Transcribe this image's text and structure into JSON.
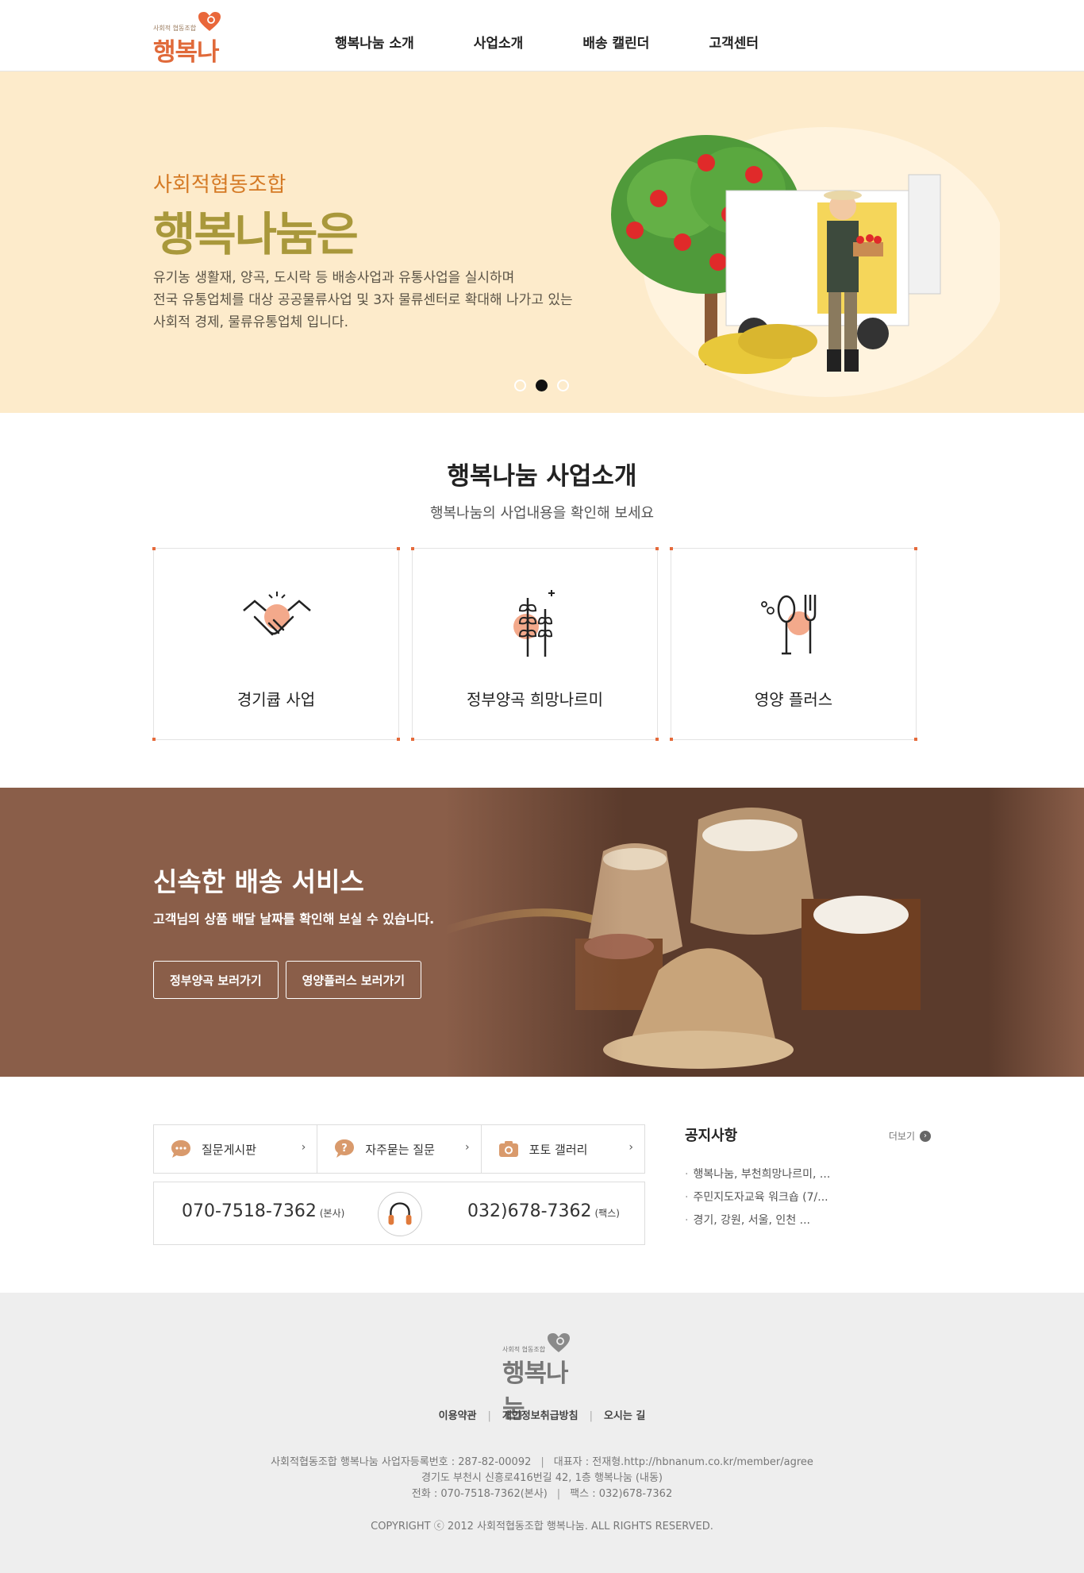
{
  "brand": {
    "small": "사회적 협동조합",
    "name": "행복나눔",
    "accent": "#e06a3a"
  },
  "nav": [
    "행복나눔 소개",
    "사업소개",
    "배송 캘린더",
    "고객센터"
  ],
  "hero": {
    "subtitle": "사회적협동조합",
    "title": "행복나눔은",
    "desc": [
      "유기농 생활재, 양곡, 도시락 등 배송사업과 유통사업을 실시하며",
      "전국 유통업체를 대상 공공물류사업 및 3자 물류센터로 확대해 나가고 있는",
      "사회적 경제, 물류유통업체 입니다."
    ],
    "slide_count": 3,
    "active_slide": 2,
    "background": "#fdebcb"
  },
  "business": {
    "heading": "행복나눔 사업소개",
    "sub": "행복나눔의 사업내용을 확인해 보세요",
    "cards": [
      {
        "label": "경기큡 사업",
        "icon": "handshake-icon"
      },
      {
        "label": "정부양곡 희망나르미",
        "icon": "wheat-icon"
      },
      {
        "label": "영양 플러스",
        "icon": "spoon-fork-icon"
      }
    ]
  },
  "delivery": {
    "title": "신속한 배송 서비스",
    "desc": "고객님의 상품 배달 날짜를 확인해 보실 수 있습니다.",
    "buttons": [
      "정부양곡 보러가기",
      "영양플러스 보러가기"
    ],
    "background": "#8a5e49"
  },
  "support": {
    "quick": [
      {
        "label": "질문게시판",
        "icon": "chat-bubble-icon"
      },
      {
        "label": "자주묻는 질문",
        "icon": "question-bubble-icon"
      },
      {
        "label": "포토 갤러리",
        "icon": "camera-icon"
      }
    ],
    "phone_main": "070-7518-7362",
    "phone_main_tag": "(본사)",
    "phone_fax": "032)678-7362",
    "phone_fax_tag": "(팩스)"
  },
  "notice": {
    "title": "공지사항",
    "more": "더보기",
    "items": [
      "행복나눔, 부천희망나르미, ...",
      "주민지도자교육 워크숍 (7/...",
      "경기, 강원, 서울, 인천 ..."
    ]
  },
  "footer": {
    "links": [
      "이용약관",
      "개인정보취급방침",
      "오시는 길"
    ],
    "info_line1_a": "사회적협동조합 행복나눔 사업자등록번호 : 287-82-00092",
    "info_line1_b": "대표자 : 전재형.http://hbnanum.co.kr/member/agree",
    "info_line2": "경기도 부천시 신흥로416번길 42, 1층 행복나눔 (내동)",
    "info_line3_a": "전화 : 070-7518-7362(본사)",
    "info_line3_b": "팩스 : 032)678-7362",
    "copyright": "COPYRIGHT ⓒ 2012 사회적협동조합 행복나눔. ALL RIGHTS RESERVED."
  }
}
